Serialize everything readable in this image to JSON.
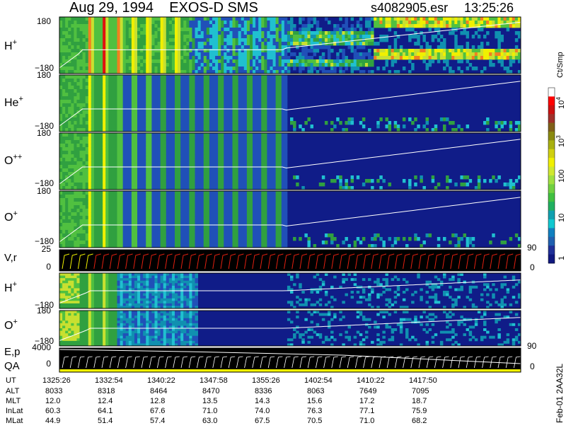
{
  "header": {
    "title": "Aug 29, 1994    EXOS-D SMS",
    "file": "s4082905.esr",
    "time": "13:25:26"
  },
  "colorbar": {
    "unit_label": "Ct/Smp",
    "ticks": [
      "10",
      "10",
      "100",
      "10",
      "1"
    ],
    "tick_values": [
      10000,
      1000,
      100,
      10,
      1
    ],
    "exponents": [
      "4",
      "3"
    ],
    "colors": [
      "#ffffff",
      "#ff0000",
      "#cc1010",
      "#a0302a",
      "#806018",
      "#8a8a10",
      "#a8b010",
      "#d0d010",
      "#f0f000",
      "#d0e830",
      "#a0e040",
      "#70d040",
      "#40c040",
      "#20b060",
      "#10a0b0",
      "#10c8d0",
      "#1080c0",
      "#2060b0",
      "#203098",
      "#101880"
    ]
  },
  "chart_data": [
    {
      "type": "heatmap",
      "panel": "H+",
      "label": "H",
      "superscript": "+",
      "y_ticks": [
        "180",
        "−180"
      ],
      "ylim": [
        -180,
        180
      ],
      "x_range": [
        "13:25:26",
        "14:20:00"
      ],
      "overlay": "pitch-angle trace (white)",
      "features": "strong counts early (red/orange bands 13:26–13:35), diffuse yellow/green bands later"
    },
    {
      "type": "heatmap",
      "panel": "He+",
      "label": "He",
      "superscript": "+",
      "y_ticks": [
        "180",
        "−180"
      ],
      "ylim": [
        -180,
        180
      ],
      "features": "spin-modulated vertical stripes until ~13:55, mostly background afterwards"
    },
    {
      "type": "heatmap",
      "panel": "O++",
      "label": "O",
      "superscript": "++",
      "y_ticks": [
        "180",
        "−180"
      ],
      "ylim": [
        -180,
        180
      ],
      "features": "spin-modulated vertical stripes until ~13:55, mostly background afterwards"
    },
    {
      "type": "heatmap",
      "panel": "O+",
      "label": "O",
      "superscript": "+",
      "y_ticks": [
        "180",
        "−180"
      ],
      "ylim": [
        -180,
        180
      ],
      "features": "spin-modulated vertical stripes until ~13:55, patches afterwards"
    },
    {
      "type": "line",
      "panel": "V,r",
      "label": "V,r",
      "y_ticks": [
        "25",
        "0"
      ],
      "right_ticks": [
        "90",
        "0"
      ],
      "ylim": [
        0,
        25
      ]
    },
    {
      "type": "heatmap",
      "panel": "H+ (energy)",
      "label": "H",
      "superscript": "+",
      "y_ticks": [
        "−180",
        "180"
      ]
    },
    {
      "type": "heatmap",
      "panel": "O+ (energy)",
      "label": "O",
      "superscript": "+",
      "y_ticks": [
        "180",
        "−180"
      ]
    },
    {
      "type": "line",
      "panel": "E,p QA",
      "label": "E,p",
      "label2": "QA",
      "y_ticks": [
        "4000",
        "0"
      ],
      "right_ticks": [
        "90",
        "0"
      ]
    }
  ],
  "ephemeris": {
    "row_labels": [
      "UT",
      "ALT",
      "MLT",
      "InLat",
      "MLat"
    ],
    "columns": [
      [
        "1325:26",
        "8033",
        "12.0",
        "60.3",
        "44.9"
      ],
      [
        "1332:54",
        "8318",
        "12.4",
        "64.1",
        "51.4"
      ],
      [
        "1340:22",
        "8464",
        "12.8",
        "67.6",
        "57.4"
      ],
      [
        "1347:58",
        "8470",
        "13.5",
        "71.0",
        "63.0"
      ],
      [
        "1355:26",
        "8336",
        "14.3",
        "74.0",
        "67.5"
      ],
      [
        "1402:54",
        "8063",
        "15.6",
        "76.3",
        "70.5"
      ],
      [
        "1410:22",
        "7649",
        "17.2",
        "77.1",
        "71.0"
      ],
      [
        "1417:50",
        "7095",
        "18.7",
        "75.9",
        "68.2"
      ]
    ]
  },
  "footer_note": "Feb-01 2AA32L"
}
